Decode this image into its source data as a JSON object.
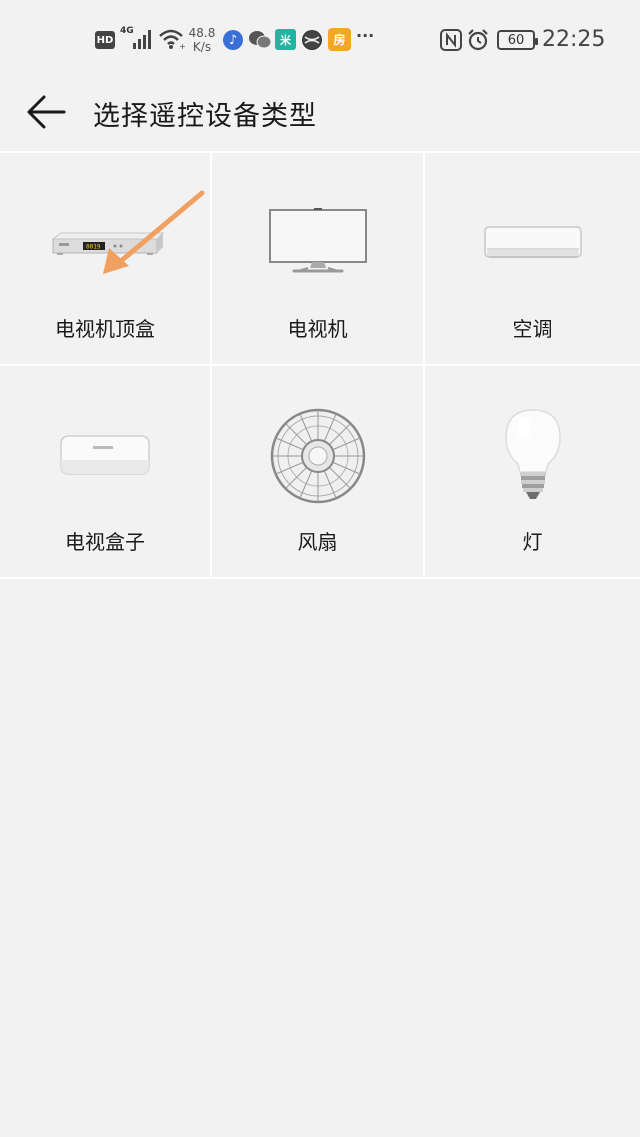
{
  "status_bar": {
    "hd": "HD",
    "network": "4G",
    "speed_value": "48.8",
    "speed_unit": "K/s",
    "mi_icon_text": "米",
    "house_icon_text": "房",
    "more": "···",
    "battery": "60",
    "time": "22:25"
  },
  "header": {
    "title": "选择遥控设备类型"
  },
  "devices": [
    {
      "label": "电视机顶盒",
      "icon": "set-top-box-icon"
    },
    {
      "label": "电视机",
      "icon": "television-icon"
    },
    {
      "label": "空调",
      "icon": "air-conditioner-icon"
    },
    {
      "label": "电视盒子",
      "icon": "tv-box-icon"
    },
    {
      "label": "风扇",
      "icon": "fan-icon"
    },
    {
      "label": "灯",
      "icon": "light-bulb-icon"
    }
  ],
  "colors": {
    "background": "#f2f2f2",
    "annotation_arrow": "#f0a060",
    "text": "#1a1a1a"
  }
}
